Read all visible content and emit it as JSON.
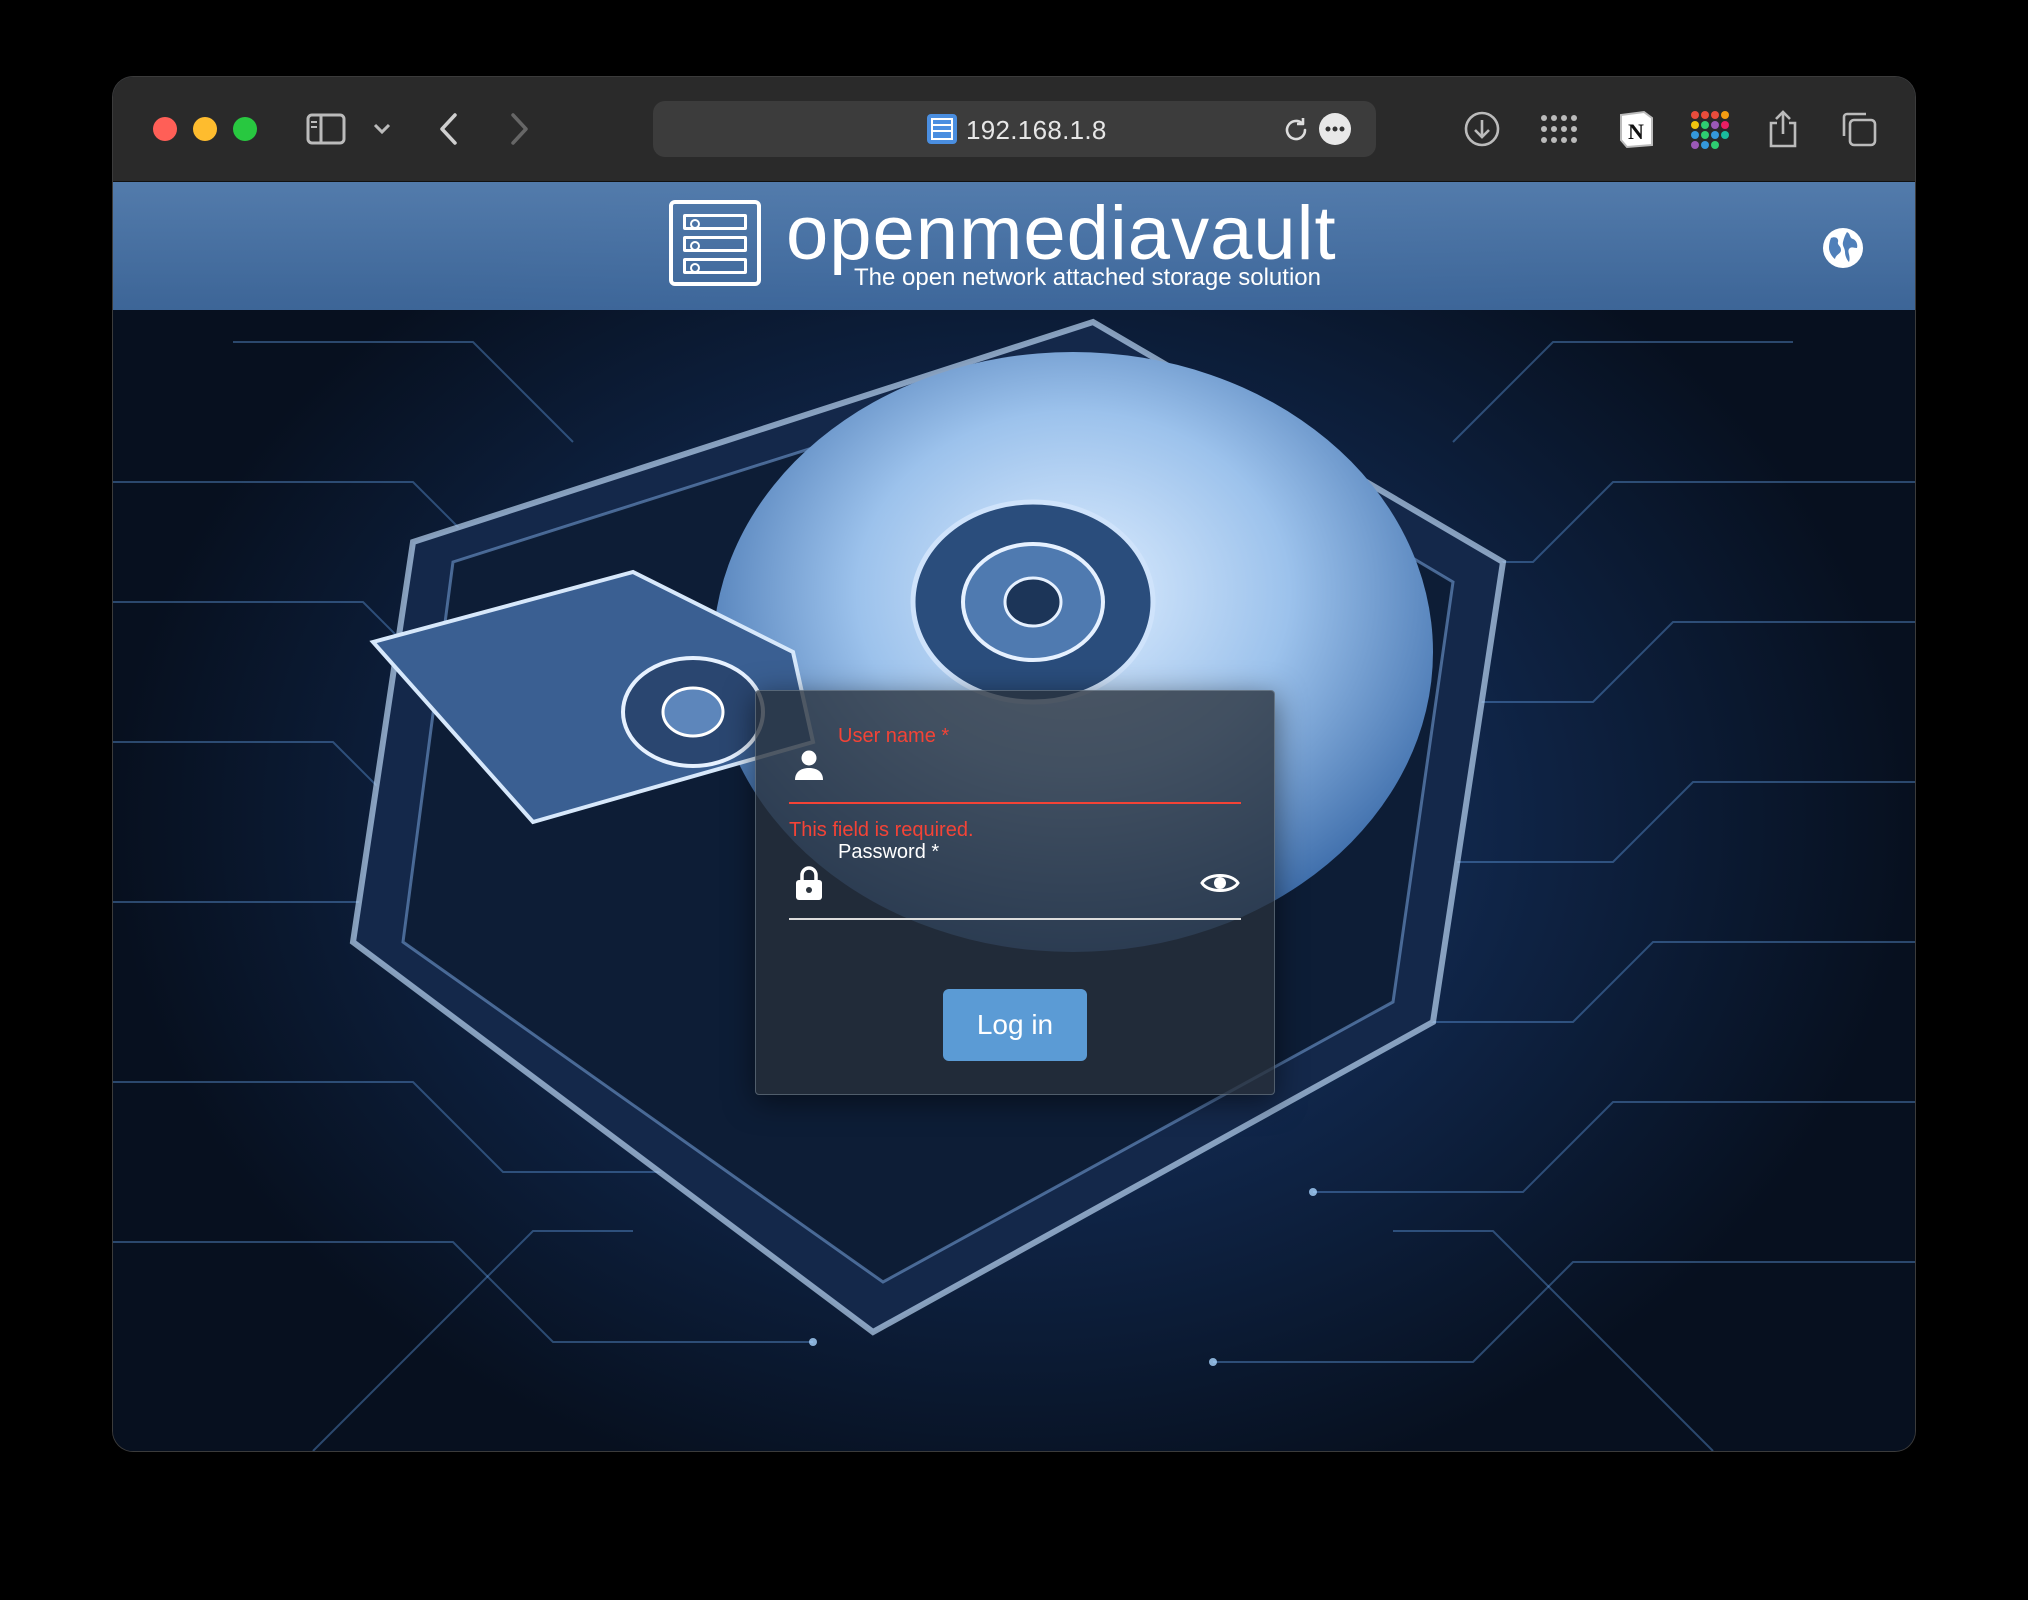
{
  "browser": {
    "url": "192.168.1.8",
    "icons": [
      "sidebar-icon",
      "chevron-down-icon",
      "back-icon",
      "forward-icon",
      "page-icon",
      "reload-icon",
      "more-icon",
      "download-icon",
      "grid-apps-icon",
      "notion-icon",
      "colorful-grid-icon",
      "share-icon",
      "tabs-icon"
    ]
  },
  "header": {
    "brand": "openmediavault",
    "tagline": "The open network attached storage solution",
    "language_icon": "globe-icon"
  },
  "login": {
    "username_label": "User name *",
    "username_error": "This field is required.",
    "password_label": "Password *",
    "login_button": "Log in",
    "error_color": "#f44336",
    "button_color": "#5b9bd5"
  }
}
